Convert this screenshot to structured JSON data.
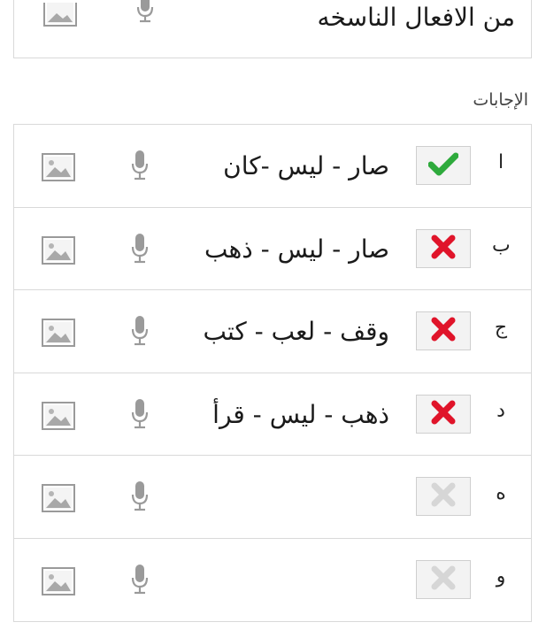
{
  "question": {
    "text": "من الافعال الناسخه"
  },
  "answers_section": {
    "label": "الإجابات"
  },
  "answers": [
    {
      "letter": "ا",
      "text": "صار - ليس -كان",
      "state": "correct"
    },
    {
      "letter": "ب",
      "text": "صار - ليس - ذهب",
      "state": "wrong"
    },
    {
      "letter": "ج",
      "text": "وقف - لعب - كتب",
      "state": "wrong"
    },
    {
      "letter": "د",
      "text": "ذهب - ليس - قرأ",
      "state": "wrong"
    },
    {
      "letter": "ه",
      "text": "",
      "state": "empty"
    },
    {
      "letter": "و",
      "text": "",
      "state": "empty"
    }
  ],
  "icons": {
    "correct": "check-icon",
    "wrong": "cross-icon",
    "empty": "cross-icon-disabled",
    "mic": "microphone-icon",
    "image": "image-icon"
  },
  "colors": {
    "correct": "#2eaa3c",
    "wrong": "#e0142a",
    "disabled": "#d6d6d6",
    "icon_gray": "#9a9a9a"
  }
}
